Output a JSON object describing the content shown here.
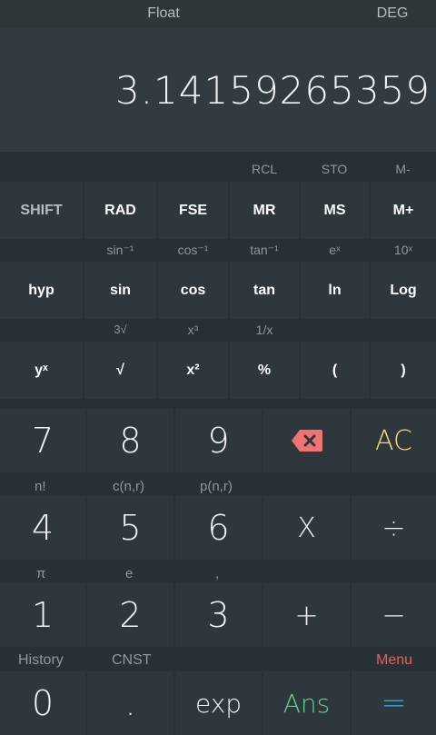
{
  "status": {
    "mode": "Float",
    "angle": "DEG"
  },
  "display": {
    "value": "3.14159265359"
  },
  "sci": {
    "row1_labels": [
      "",
      "",
      "",
      "RCL",
      "STO",
      "M-"
    ],
    "row1_keys": [
      "SHIFT",
      "RAD",
      "FSE",
      "MR",
      "MS",
      "M+"
    ],
    "row2_labels": [
      "",
      "sin⁻¹",
      "cos⁻¹",
      "tan⁻¹",
      "eˣ",
      "10ˣ"
    ],
    "row2_keys": [
      "hyp",
      "sin",
      "cos",
      "tan",
      "ln",
      "Log"
    ],
    "row3_labels": [
      "",
      "3√",
      "x³",
      "1/x",
      "",
      ""
    ],
    "row3_keys": [
      "yˣ",
      "√",
      "x²",
      "%",
      "(",
      ")"
    ]
  },
  "digits": {
    "row1": [
      "7",
      "8",
      "9",
      "",
      "AC"
    ],
    "row2_labels": [
      "n!",
      "c(n,r)",
      "p(n,r)",
      "",
      ""
    ],
    "row2": [
      "4",
      "5",
      "6",
      "X",
      "÷"
    ],
    "row3_labels": [
      "π",
      "e",
      ",",
      "",
      ""
    ],
    "row3": [
      "1",
      "2",
      "3",
      "+",
      "−"
    ],
    "row4_labels": [
      "History",
      "CNST",
      "",
      "",
      "Menu"
    ],
    "row4": [
      "0",
      ".",
      "exp",
      "Ans",
      "="
    ]
  },
  "colors": {
    "ac": "#f3d77a",
    "ans": "#5fd28b",
    "equals": "#35a6e4",
    "menu": "#e36257",
    "backspace": "#f07474"
  }
}
